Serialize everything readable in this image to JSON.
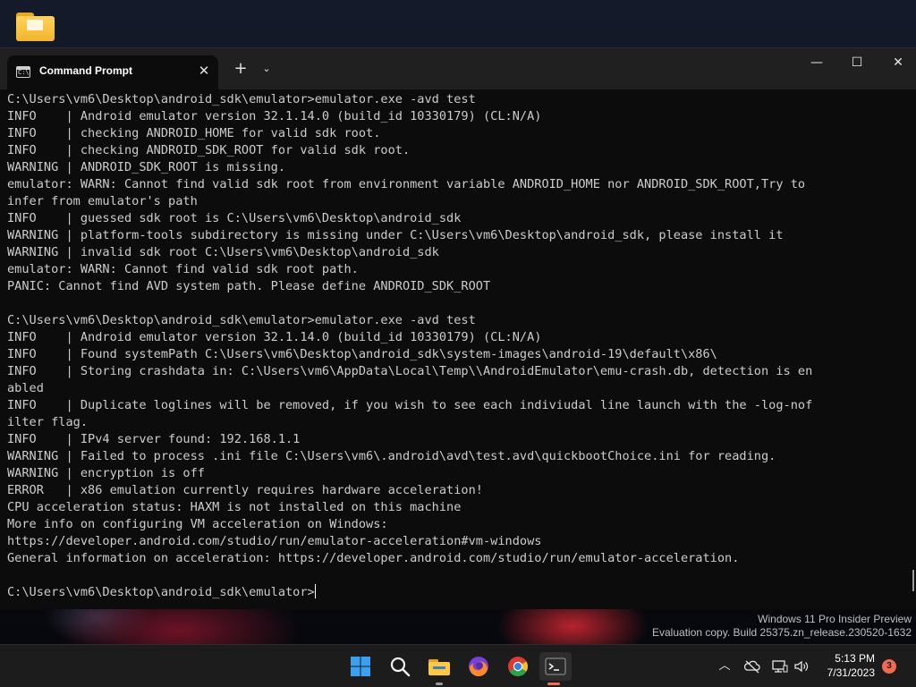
{
  "window": {
    "tab_title": "Command Prompt",
    "tab_icon_text": "C:\\",
    "close_tab": "✕",
    "new_tab": "+",
    "dropdown": "⌄",
    "minimize": "—",
    "maximize": "☐",
    "close": "✕"
  },
  "console": {
    "lines": [
      "C:\\Users\\vm6\\Desktop\\android_sdk\\emulator>emulator.exe -avd test",
      "INFO    | Android emulator version 32.1.14.0 (build_id 10330179) (CL:N/A)",
      "INFO    | checking ANDROID_HOME for valid sdk root.",
      "INFO    | checking ANDROID_SDK_ROOT for valid sdk root.",
      "WARNING | ANDROID_SDK_ROOT is missing.",
      "emulator: WARN: Cannot find valid sdk root from environment variable ANDROID_HOME nor ANDROID_SDK_ROOT,Try to",
      "infer from emulator's path",
      "INFO    | guessed sdk root is C:\\Users\\vm6\\Desktop\\android_sdk",
      "WARNING | platform-tools subdirectory is missing under C:\\Users\\vm6\\Desktop\\android_sdk, please install it",
      "WARNING | invalid sdk root C:\\Users\\vm6\\Desktop\\android_sdk",
      "emulator: WARN: Cannot find valid sdk root path.",
      "PANIC: Cannot find AVD system path. Please define ANDROID_SDK_ROOT",
      "",
      "C:\\Users\\vm6\\Desktop\\android_sdk\\emulator>emulator.exe -avd test",
      "INFO    | Android emulator version 32.1.14.0 (build_id 10330179) (CL:N/A)",
      "INFO    | Found systemPath C:\\Users\\vm6\\Desktop\\android_sdk\\system-images\\android-19\\default\\x86\\",
      "INFO    | Storing crashdata in: C:\\Users\\vm6\\AppData\\Local\\Temp\\\\AndroidEmulator\\emu-crash.db, detection is en",
      "abled",
      "INFO    | Duplicate loglines will be removed, if you wish to see each indiviudal line launch with the -log-nof",
      "ilter flag.",
      "INFO    | IPv4 server found: 192.168.1.1",
      "WARNING | Failed to process .ini file C:\\Users\\vm6\\.android\\avd\\test.avd\\quickbootChoice.ini for reading.",
      "WARNING | encryption is off",
      "ERROR   | x86 emulation currently requires hardware acceleration!",
      "CPU acceleration status: HAXM is not installed on this machine",
      "More info on configuring VM acceleration on Windows:",
      "https://developer.android.com/studio/run/emulator-acceleration#vm-windows",
      "General information on acceleration: https://developer.android.com/studio/run/emulator-acceleration.",
      ""
    ],
    "prompt": "C:\\Users\\vm6\\Desktop\\android_sdk\\emulator>"
  },
  "watermark": {
    "line1": "Windows 11 Pro Insider Preview",
    "line2": "Evaluation copy. Build 25375.zn_release.230520-1632"
  },
  "taskbar": {
    "icons": [
      "windows-start-icon",
      "search-icon",
      "file-explorer-icon",
      "firefox-icon",
      "chrome-icon",
      "terminal-icon"
    ],
    "tray_chevron": "︿",
    "time": "5:13 PM",
    "date": "7/31/2023",
    "notification_count": "3"
  },
  "colors": {
    "console_bg": "#0c0c0c",
    "console_text": "#cccccc",
    "titlebar": "#202020",
    "taskbar": "#1c1c1c",
    "notification_badge": "#f06b4f"
  }
}
